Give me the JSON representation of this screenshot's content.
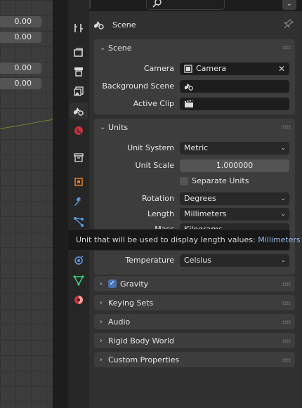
{
  "viewport": {
    "fields": [
      "0.00",
      "0.00",
      "0.00",
      "0.00"
    ]
  },
  "header": {
    "context_title": "Scene"
  },
  "tabs": [
    {
      "name": "tool-tab-icon",
      "active": false
    },
    {
      "name": "render-tab-icon",
      "active": false
    },
    {
      "name": "output-tab-icon",
      "active": false
    },
    {
      "name": "view-layer-tab-icon",
      "active": false
    },
    {
      "name": "scene-tab-icon",
      "active": true
    },
    {
      "name": "world-tab-icon",
      "active": false
    },
    {
      "name": "collection-tab-icon",
      "active": false
    },
    {
      "name": "object-tab-icon",
      "active": false
    },
    {
      "name": "modifier-tab-icon",
      "active": false
    },
    {
      "name": "particles-tab-icon",
      "active": false
    },
    {
      "name": "physics-tab-icon",
      "active": false
    },
    {
      "name": "constraints-tab-icon",
      "active": false
    },
    {
      "name": "data-tab-icon",
      "active": false
    },
    {
      "name": "material-tab-icon",
      "active": false
    }
  ],
  "scene_panel": {
    "title": "Scene",
    "camera_label": "Camera",
    "camera_value": "Camera",
    "background_scene_label": "Background Scene",
    "active_clip_label": "Active Clip"
  },
  "units_panel": {
    "title": "Units",
    "unit_system_label": "Unit System",
    "unit_system_value": "Metric",
    "unit_scale_label": "Unit Scale",
    "unit_scale_value": "1.000000",
    "separate_units_label": "Separate Units",
    "rotation_label": "Rotation",
    "rotation_value": "Degrees",
    "length_label": "Length",
    "length_value": "Millimeters",
    "mass_label": "Mass",
    "mass_value": "Kilograms",
    "temperature_label": "Temperature",
    "temperature_value": "Celsius"
  },
  "tooltip": {
    "text": "Unit that will be used to display length values:",
    "value": "Millimeters"
  },
  "collapsed_panels": {
    "gravity": "Gravity",
    "keying_sets": "Keying Sets",
    "audio": "Audio",
    "rigid_body_world": "Rigid Body World",
    "custom_properties": "Custom Properties"
  },
  "colors": {
    "accent": "#4772b3",
    "panel": "#3d3d3d",
    "background": "#303030",
    "tooltip_value": "#96b4e6"
  }
}
